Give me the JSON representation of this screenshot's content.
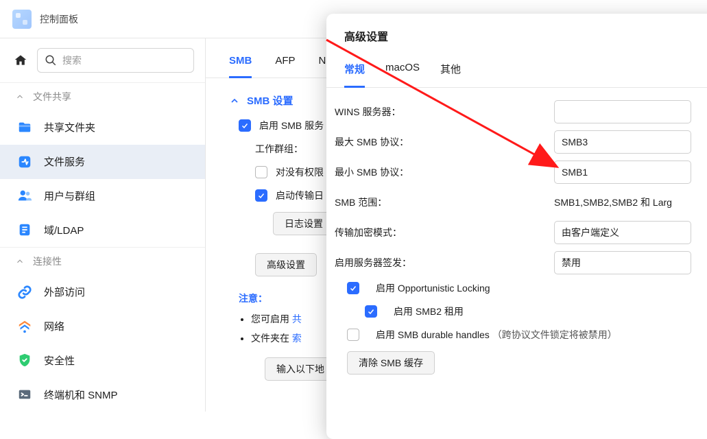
{
  "window": {
    "title": "控制面板"
  },
  "search": {
    "placeholder": "搜索"
  },
  "sections": {
    "file_sharing": "文件共享",
    "connectivity": "连接性"
  },
  "nav": {
    "shared_folder": "共享文件夹",
    "file_services": "文件服务",
    "user_group": "用户与群组",
    "domain_ldap": "域/LDAP",
    "external_access": "外部访问",
    "network": "网络",
    "security": "安全性",
    "terminal_snmp": "终端机和 SNMP"
  },
  "main_tabs": {
    "smb": "SMB",
    "afp": "AFP",
    "nfs_initial": "N"
  },
  "smb": {
    "section_title": "SMB 设置",
    "enable_smb": "启用 SMB 服务",
    "workgroup_label": "工作群组：",
    "deny_no_perm_partial": "对没有权限",
    "enable_transfer_partial": "启动传输日",
    "log_settings_btn": "日志设置",
    "advanced_btn": "高级设置",
    "note_head": "注意：",
    "note1_prefix": "您可启用 ",
    "note1_link": "共",
    "note2_prefix": "文件夹在 ",
    "note2_link": "索",
    "input_below_partial": "输入以下地"
  },
  "dialog": {
    "title": "高级设置",
    "tabs": {
      "general": "常规",
      "macos": "macOS",
      "other": "其他"
    },
    "wins_label": "WINS 服务器：",
    "max_smb_label": "最大 SMB 协议：",
    "max_smb_value": "SMB3",
    "min_smb_label": "最小 SMB 协议：",
    "min_smb_value": "SMB1",
    "smb_range_label": "SMB 范围：",
    "smb_range_value": "SMB1,SMB2,SMB2 和 Larg",
    "encrypt_label": "传输加密模式：",
    "encrypt_value": "由客户端定义",
    "signing_label": "启用服务器签发：",
    "signing_value": "禁用",
    "opp_lock": "启用 Opportunistic Locking",
    "smb2_lease": "启用 SMB2 租用",
    "durable": "启用 SMB durable handles",
    "durable_hint": "（跨协议文件锁定将被禁用）",
    "clear_cache": "清除 SMB 缓存"
  }
}
